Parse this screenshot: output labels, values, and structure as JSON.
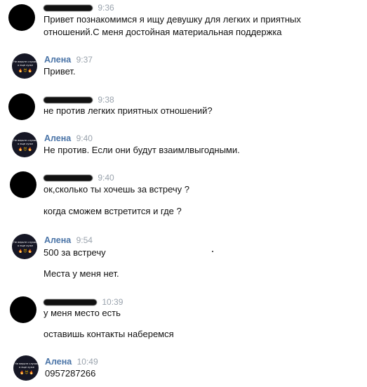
{
  "messages": [
    {
      "sender": "anonymous",
      "time": "9:36",
      "lines": [
        "Привет познакомимся я ищу девушку для легких и приятных",
        "отношений.С меня достойная материальная поддержка"
      ]
    },
    {
      "sender": "Алена",
      "time": "9:37",
      "lines": [
        "Привет."
      ]
    },
    {
      "sender": "anonymous",
      "time": "9:38",
      "lines": [
        "не против легких приятных отношений?"
      ]
    },
    {
      "sender": "Алена",
      "time": "9:40",
      "lines": [
        "Не против. Если они будут взаимлвыгодными."
      ]
    },
    {
      "sender": "anonymous",
      "time": "9:40",
      "lines": [
        "ок,сколько ты хочешь за встречу ?",
        "когда сможем встретится и где ?"
      ]
    },
    {
      "sender": "Алена",
      "time": "9:54",
      "lines": [
        "500 за встречу",
        "Места у меня нет."
      ]
    },
    {
      "sender": "anonymous",
      "time": "10:39",
      "lines": [
        "у меня место есть",
        "оставишь контакты наберемся"
      ]
    },
    {
      "sender": "Алена",
      "time": "10:49",
      "lines": [
        "0957287266"
      ]
    }
  ],
  "avatar_caption": [
    "Не верьте слухам",
    "я еще хуже"
  ],
  "avatar_emoji": "🔥😈🔥",
  "colors": {
    "name": "#4a74a7",
    "time": "#9aa3ad",
    "text": "#111111"
  }
}
